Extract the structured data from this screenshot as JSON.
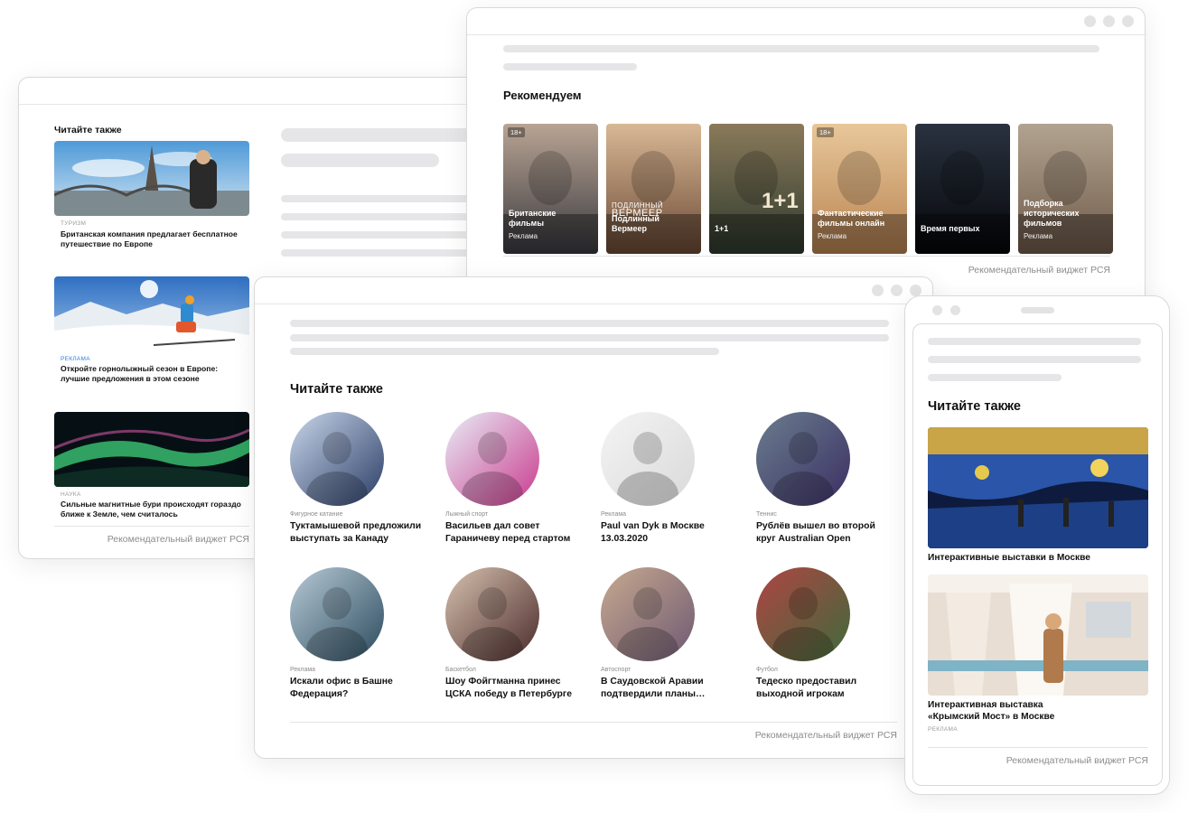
{
  "left_widget": {
    "heading": "Читайте также",
    "items": [
      {
        "category": "ТУРИЗМ",
        "title_line1": "Британская компания предлагает бесплатное",
        "title_line2": "путешествие по Европе"
      },
      {
        "category": "РЕКЛАМА",
        "title_line1": "Откройте горнолыжный сезон в Европе:",
        "title_line2": "лучшие предложения в этом сезоне"
      },
      {
        "category": "НАУКА",
        "title_line1": "Сильные магнитные бури происходят гораздо",
        "title_line2": "ближе к Земле, чем считалось"
      }
    ],
    "footer": "Рекомендательный виджет РСЯ"
  },
  "right_widget": {
    "heading": "Рекомендуем",
    "posters": [
      {
        "label": "Британские фильмы",
        "ad": "Реклама",
        "age": "18+",
        "colors": [
          "#3a3a40",
          "#b9a493"
        ]
      },
      {
        "label": "Подлинный Вермеер",
        "ad": "",
        "age": "",
        "colors": [
          "#6b4a35",
          "#d9b896"
        ]
      },
      {
        "label": "1+1",
        "ad": "",
        "age": "",
        "colors": [
          "#2f3a2e",
          "#8a7a5a"
        ]
      },
      {
        "label": "Фантастические фильмы онлайн",
        "ad": "Реклама",
        "age": "18+",
        "colors": [
          "#b98452",
          "#e8c79a"
        ]
      },
      {
        "label": "Время первых",
        "ad": "",
        "age": "",
        "colors": [
          "#050608",
          "#2a3240"
        ]
      },
      {
        "label": "Подборка исторических фильмов",
        "ad": "Реклама",
        "age": "",
        "colors": [
          "#6f5a4a",
          "#b2a390"
        ]
      }
    ],
    "poster_art_texts": {
      "poster2_line1": "ПОДЛИННЫЙ",
      "poster2_line2": "ВЕРМЕЕР",
      "poster3_big": "1+1"
    },
    "footer": "Рекомендательный виджет РСЯ"
  },
  "center_widget": {
    "heading": "Читайте также",
    "items": [
      {
        "category": "Фигурное катание",
        "title_line1": "Туктамышевой предложили",
        "title_line2": "выступать за Канаду",
        "colors": [
          "#2a3d66",
          "#c9d6ea"
        ]
      },
      {
        "category": "Лыжный спорт",
        "title_line1": "Васильев дал совет",
        "title_line2": "Гараничеву перед стартом",
        "colors": [
          "#c93a8e",
          "#e8eef6"
        ]
      },
      {
        "category": "Реклама",
        "title_line1": "Paul van Dyk в Москве",
        "title_line2": "13.03.2020",
        "colors": [
          "#d9d9d9",
          "#f4f4f4"
        ]
      },
      {
        "category": "Теннис",
        "title_line1": "Рублёв вышел во второй",
        "title_line2": "круг Australian Open",
        "colors": [
          "#3b2f63",
          "#6a7d8e"
        ]
      },
      {
        "category": "Реклама",
        "title_line1": "Искали офис в Башне",
        "title_line2": "Федерация?",
        "colors": [
          "#2b4b5e",
          "#b8cad6"
        ]
      },
      {
        "category": "Баскетбол",
        "title_line1": "Шоу Фойгтманна принес",
        "title_line2": "ЦСКА победу в Петербурге",
        "colors": [
          "#4a2a2a",
          "#d7c2b0"
        ]
      },
      {
        "category": "Автоспорт",
        "title_line1": "В Саудовской Аравии",
        "title_line2": "подтвердили планы…",
        "colors": [
          "#6e5a73",
          "#c7a98f"
        ]
      },
      {
        "category": "Футбол",
        "title_line1": "Тедеско предоставил",
        "title_line2": "выходной игрокам",
        "colors": [
          "#3d6b3a",
          "#b04444"
        ]
      }
    ],
    "footer": "Рекомендательный виджет РСЯ"
  },
  "mobile_widget": {
    "heading": "Читайте также",
    "items": [
      {
        "title_line1": "Интерактивные выставки в Москве",
        "title_line2": "",
        "category": ""
      },
      {
        "title_line1": "Интерактивная выставка",
        "title_line2": "«Крымский Мост» в Москве",
        "category": "РЕКЛАМА"
      }
    ],
    "footer": "Рекомендательный виджет РСЯ"
  }
}
